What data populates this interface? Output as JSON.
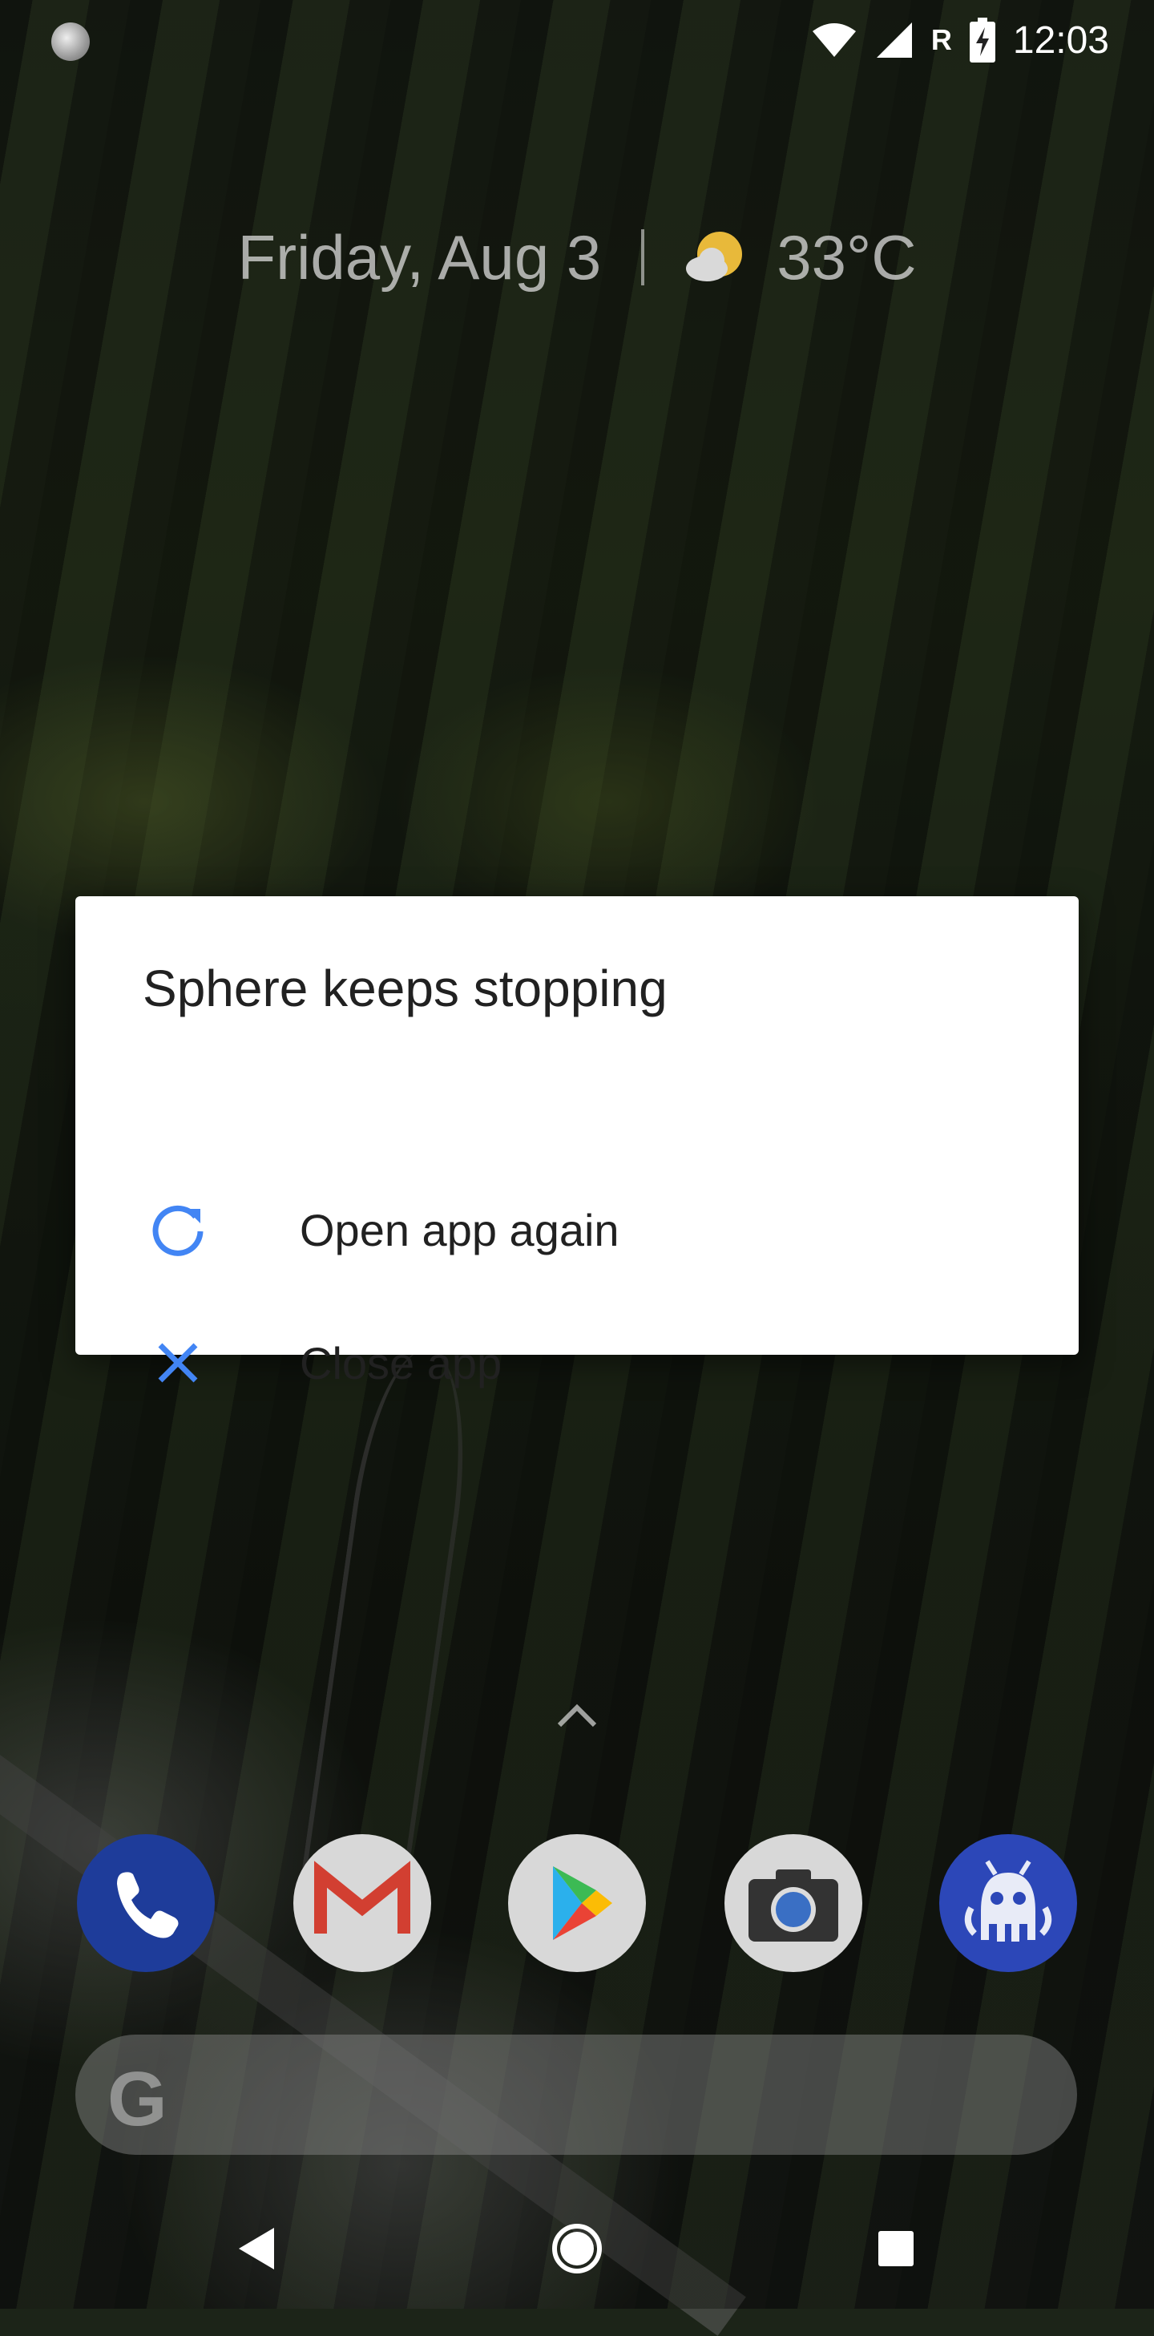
{
  "status_bar": {
    "time": "12:03",
    "roaming_indicator": "R",
    "icons": [
      "loading-icon",
      "wifi-icon",
      "signal-icon",
      "battery-charging-icon"
    ]
  },
  "widget": {
    "date": "Friday, Aug 3",
    "temperature": "33°C",
    "weather_icon": "partly-cloudy-icon"
  },
  "dialog": {
    "title": "Sphere keeps stopping",
    "options": [
      {
        "label": "Open app again",
        "icon": "refresh-icon"
      },
      {
        "label": "Close app",
        "icon": "close-icon"
      }
    ],
    "accent_color": "#4285F4"
  },
  "dock": {
    "apps": [
      "phone-app-icon",
      "gmail-app-icon",
      "play-store-app-icon",
      "camera-app-icon",
      "octopus-robot-app-icon"
    ]
  },
  "search_bar": {
    "logo": "G"
  },
  "nav_bar": {
    "buttons": [
      "back-button",
      "home-button",
      "recents-button"
    ]
  }
}
